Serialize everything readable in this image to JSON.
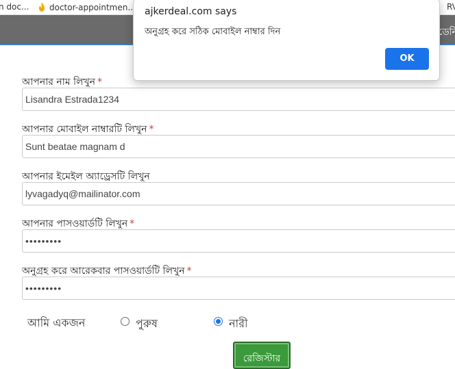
{
  "bookmarks": {
    "item1": "n doc...",
    "item2": "doctor-appointmen...",
    "item3": "RVE"
  },
  "nav": {
    "item": "ডেনি"
  },
  "dialog": {
    "title": "ajkerdeal.com says",
    "message": "অনুগ্রহ করে সঠিক মোবাইল নাম্বার দিন",
    "ok_label": "OK"
  },
  "form": {
    "name_label": "আপনার নাম লিখুন",
    "name_value": "Lisandra Estrada1234",
    "mobile_label": "আপনার মোবাইল নাম্বারটি লিখুন",
    "mobile_value": "Sunt beatae magnam d",
    "email_label": "আপনার ইমেইল অ্যাড্রেসটি লিখুন",
    "email_value": "lyvagadyq@mailinator.com",
    "password_label": "আপনার পাসওয়ার্ডটি লিখুন",
    "password_value": "•••••••••",
    "confirm_label": "অনুগ্রহ করে আরেকবার পাসওয়ার্ডটি লিখুন",
    "confirm_value": "•••••••••",
    "required_mark": "*",
    "gender_prompt": "আমি একজন",
    "gender_male": "পুরুষ",
    "gender_female": "নারী",
    "gender_selected": "নারী",
    "submit_label": "রেজিস্টার"
  },
  "colors": {
    "nav_bg": "#6b6b6b",
    "accent": "#1a73e8",
    "submit_bg": "#3b9a3b",
    "required": "#d23a3a"
  },
  "icons": {
    "bookmark2": "flame-bookmark-icon"
  }
}
